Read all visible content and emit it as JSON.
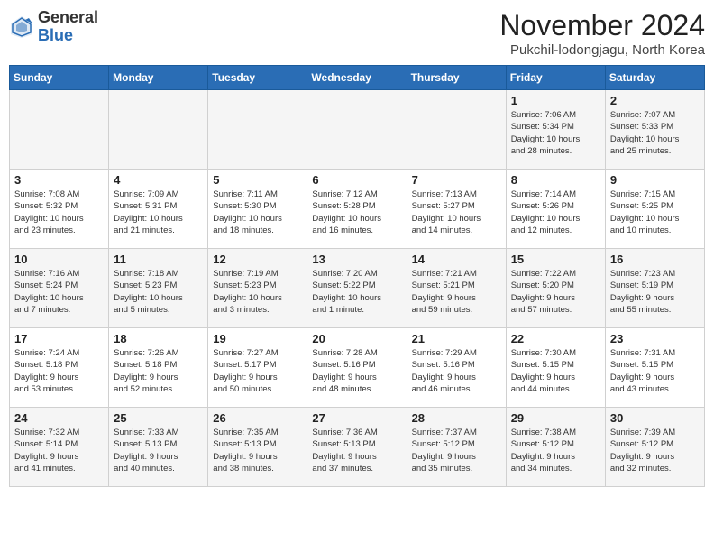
{
  "logo": {
    "general": "General",
    "blue": "Blue"
  },
  "title": "November 2024",
  "subtitle": "Pukchil-lodongjagu, North Korea",
  "weekdays": [
    "Sunday",
    "Monday",
    "Tuesday",
    "Wednesday",
    "Thursday",
    "Friday",
    "Saturday"
  ],
  "weeks": [
    [
      {
        "day": "",
        "info": ""
      },
      {
        "day": "",
        "info": ""
      },
      {
        "day": "",
        "info": ""
      },
      {
        "day": "",
        "info": ""
      },
      {
        "day": "",
        "info": ""
      },
      {
        "day": "1",
        "info": "Sunrise: 7:06 AM\nSunset: 5:34 PM\nDaylight: 10 hours\nand 28 minutes."
      },
      {
        "day": "2",
        "info": "Sunrise: 7:07 AM\nSunset: 5:33 PM\nDaylight: 10 hours\nand 25 minutes."
      }
    ],
    [
      {
        "day": "3",
        "info": "Sunrise: 7:08 AM\nSunset: 5:32 PM\nDaylight: 10 hours\nand 23 minutes."
      },
      {
        "day": "4",
        "info": "Sunrise: 7:09 AM\nSunset: 5:31 PM\nDaylight: 10 hours\nand 21 minutes."
      },
      {
        "day": "5",
        "info": "Sunrise: 7:11 AM\nSunset: 5:30 PM\nDaylight: 10 hours\nand 18 minutes."
      },
      {
        "day": "6",
        "info": "Sunrise: 7:12 AM\nSunset: 5:28 PM\nDaylight: 10 hours\nand 16 minutes."
      },
      {
        "day": "7",
        "info": "Sunrise: 7:13 AM\nSunset: 5:27 PM\nDaylight: 10 hours\nand 14 minutes."
      },
      {
        "day": "8",
        "info": "Sunrise: 7:14 AM\nSunset: 5:26 PM\nDaylight: 10 hours\nand 12 minutes."
      },
      {
        "day": "9",
        "info": "Sunrise: 7:15 AM\nSunset: 5:25 PM\nDaylight: 10 hours\nand 10 minutes."
      }
    ],
    [
      {
        "day": "10",
        "info": "Sunrise: 7:16 AM\nSunset: 5:24 PM\nDaylight: 10 hours\nand 7 minutes."
      },
      {
        "day": "11",
        "info": "Sunrise: 7:18 AM\nSunset: 5:23 PM\nDaylight: 10 hours\nand 5 minutes."
      },
      {
        "day": "12",
        "info": "Sunrise: 7:19 AM\nSunset: 5:23 PM\nDaylight: 10 hours\nand 3 minutes."
      },
      {
        "day": "13",
        "info": "Sunrise: 7:20 AM\nSunset: 5:22 PM\nDaylight: 10 hours\nand 1 minute."
      },
      {
        "day": "14",
        "info": "Sunrise: 7:21 AM\nSunset: 5:21 PM\nDaylight: 9 hours\nand 59 minutes."
      },
      {
        "day": "15",
        "info": "Sunrise: 7:22 AM\nSunset: 5:20 PM\nDaylight: 9 hours\nand 57 minutes."
      },
      {
        "day": "16",
        "info": "Sunrise: 7:23 AM\nSunset: 5:19 PM\nDaylight: 9 hours\nand 55 minutes."
      }
    ],
    [
      {
        "day": "17",
        "info": "Sunrise: 7:24 AM\nSunset: 5:18 PM\nDaylight: 9 hours\nand 53 minutes."
      },
      {
        "day": "18",
        "info": "Sunrise: 7:26 AM\nSunset: 5:18 PM\nDaylight: 9 hours\nand 52 minutes."
      },
      {
        "day": "19",
        "info": "Sunrise: 7:27 AM\nSunset: 5:17 PM\nDaylight: 9 hours\nand 50 minutes."
      },
      {
        "day": "20",
        "info": "Sunrise: 7:28 AM\nSunset: 5:16 PM\nDaylight: 9 hours\nand 48 minutes."
      },
      {
        "day": "21",
        "info": "Sunrise: 7:29 AM\nSunset: 5:16 PM\nDaylight: 9 hours\nand 46 minutes."
      },
      {
        "day": "22",
        "info": "Sunrise: 7:30 AM\nSunset: 5:15 PM\nDaylight: 9 hours\nand 44 minutes."
      },
      {
        "day": "23",
        "info": "Sunrise: 7:31 AM\nSunset: 5:15 PM\nDaylight: 9 hours\nand 43 minutes."
      }
    ],
    [
      {
        "day": "24",
        "info": "Sunrise: 7:32 AM\nSunset: 5:14 PM\nDaylight: 9 hours\nand 41 minutes."
      },
      {
        "day": "25",
        "info": "Sunrise: 7:33 AM\nSunset: 5:13 PM\nDaylight: 9 hours\nand 40 minutes."
      },
      {
        "day": "26",
        "info": "Sunrise: 7:35 AM\nSunset: 5:13 PM\nDaylight: 9 hours\nand 38 minutes."
      },
      {
        "day": "27",
        "info": "Sunrise: 7:36 AM\nSunset: 5:13 PM\nDaylight: 9 hours\nand 37 minutes."
      },
      {
        "day": "28",
        "info": "Sunrise: 7:37 AM\nSunset: 5:12 PM\nDaylight: 9 hours\nand 35 minutes."
      },
      {
        "day": "29",
        "info": "Sunrise: 7:38 AM\nSunset: 5:12 PM\nDaylight: 9 hours\nand 34 minutes."
      },
      {
        "day": "30",
        "info": "Sunrise: 7:39 AM\nSunset: 5:12 PM\nDaylight: 9 hours\nand 32 minutes."
      }
    ]
  ]
}
